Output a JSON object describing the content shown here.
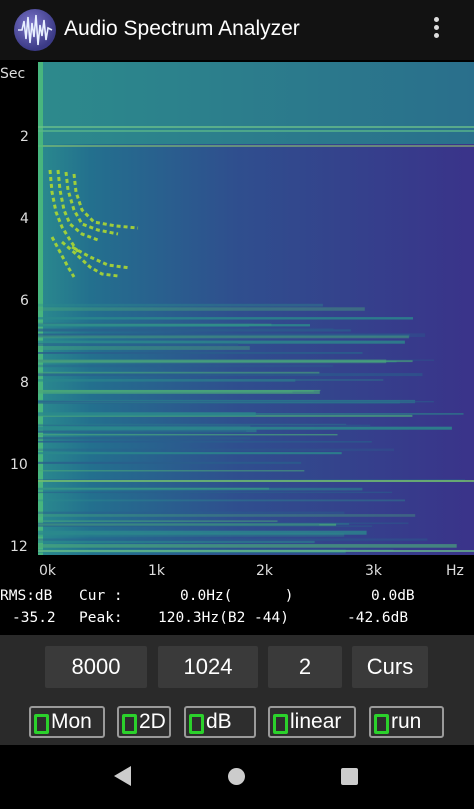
{
  "app": {
    "title": "Audio Spectrum Analyzer",
    "logo_icon": "waveform-logo-icon",
    "menu_icon": "overflow-menu-icon"
  },
  "plot": {
    "y_unit": "Sec",
    "y_ticks": [
      "2",
      "4",
      "6",
      "8",
      "10",
      "12"
    ],
    "x_ticks": [
      "0k",
      "1k",
      "2k",
      "3k"
    ],
    "x_unit": "Hz"
  },
  "readout": {
    "rms_label": "RMS:dB",
    "rms_value": "-35.2",
    "cur_label": "Cur :",
    "cur_freq": "0.0Hz(      )",
    "cur_db": "0.0dB",
    "peak_label": "Peak:",
    "peak_freq": "120.3Hz(B2 -44)",
    "peak_db": "-42.6dB"
  },
  "controls": {
    "sample_rate": "8000",
    "fft_size": "1024",
    "average": "2",
    "cursor_mode": "Curs",
    "toggles": [
      "Mon",
      "2D",
      "dB",
      "linear",
      "run"
    ]
  },
  "colors": {
    "accent": "#2bd12b",
    "spectrogram_low": "#3b2f8a",
    "spectrogram_mid": "#23708e",
    "spectrogram_high": "#b5de2b"
  },
  "navbar": {
    "back_icon": "back-triangle-icon",
    "home_icon": "home-circle-icon",
    "recents_icon": "recents-square-icon"
  }
}
